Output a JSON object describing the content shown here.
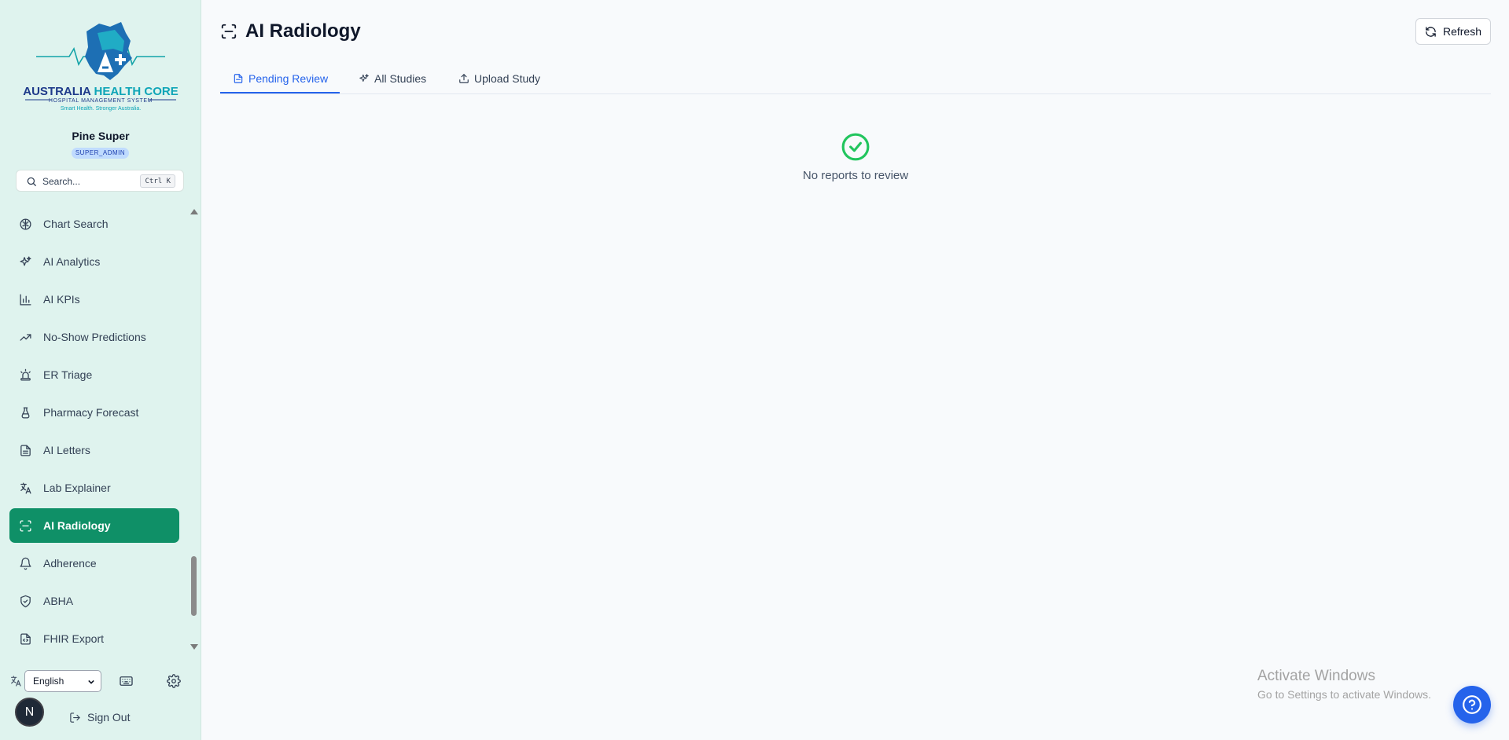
{
  "sidebar": {
    "logo": {
      "title_part1": "AUSTRALIA ",
      "title_part2": "HEALTH CORE",
      "subtitle": "HOSPITAL MANAGEMENT SYSTEM",
      "tagline": "Smart Health. Stronger Australia."
    },
    "user": {
      "name": "Pine Super",
      "role": "SUPER_ADMIN",
      "avatar_initial": "N"
    },
    "search": {
      "placeholder": "Search...",
      "shortcut": "Ctrl K"
    },
    "items": [
      {
        "label": "Chart Search",
        "icon": "brain-icon"
      },
      {
        "label": "AI Analytics",
        "icon": "sparkles-icon"
      },
      {
        "label": "AI KPIs",
        "icon": "bar-chart-icon"
      },
      {
        "label": "No-Show Predictions",
        "icon": "trending-up-icon"
      },
      {
        "label": "ER Triage",
        "icon": "siren-icon"
      },
      {
        "label": "Pharmacy Forecast",
        "icon": "flask-icon"
      },
      {
        "label": "AI Letters",
        "icon": "file-text-icon"
      },
      {
        "label": "Lab Explainer",
        "icon": "languages-icon"
      },
      {
        "label": "AI Radiology",
        "icon": "scan-icon",
        "active": true
      },
      {
        "label": "Adherence",
        "icon": "bell-icon"
      },
      {
        "label": "ABHA",
        "icon": "shield-check-icon"
      },
      {
        "label": "FHIR Export",
        "icon": "file-code-icon"
      }
    ],
    "language": "English",
    "sign_out": "Sign Out"
  },
  "main": {
    "title": "AI Radiology",
    "refresh_label": "Refresh",
    "tabs": [
      {
        "label": "Pending Review",
        "icon": "file-icon",
        "active": true
      },
      {
        "label": "All Studies",
        "icon": "sparkles-icon"
      },
      {
        "label": "Upload Study",
        "icon": "upload-icon"
      }
    ],
    "empty_message": "No reports to review"
  },
  "os_watermark": {
    "line1": "Activate Windows",
    "line2": "Go to Settings to activate Windows."
  },
  "colors": {
    "sidebar_bg": "#dff3ee",
    "active_nav": "#0f9067",
    "accent_blue": "#2563eb",
    "success_green": "#22c55e"
  }
}
